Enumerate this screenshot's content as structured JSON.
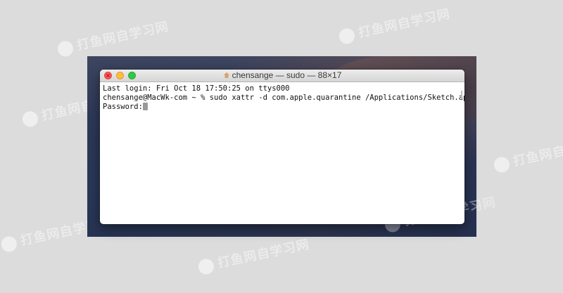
{
  "window": {
    "title": "chensange — sudo — 88×17",
    "controls": {
      "close_icon": "close-icon",
      "minimize_icon": "minimize-icon",
      "maximize_icon": "maximize-icon"
    }
  },
  "terminal": {
    "line1": "Last login: Fri Oct 18 17:50:25 on ttys000",
    "line2": "chensange@MacWk-com ~ % sudo xattr -d com.apple.quarantine /Applications/Sketch.app",
    "prompt": "Password:"
  },
  "watermark": {
    "text": "打鱼网自学习网"
  },
  "colors": {
    "close": "#fc5753",
    "minimize": "#fdbc40",
    "maximize": "#33c748"
  }
}
